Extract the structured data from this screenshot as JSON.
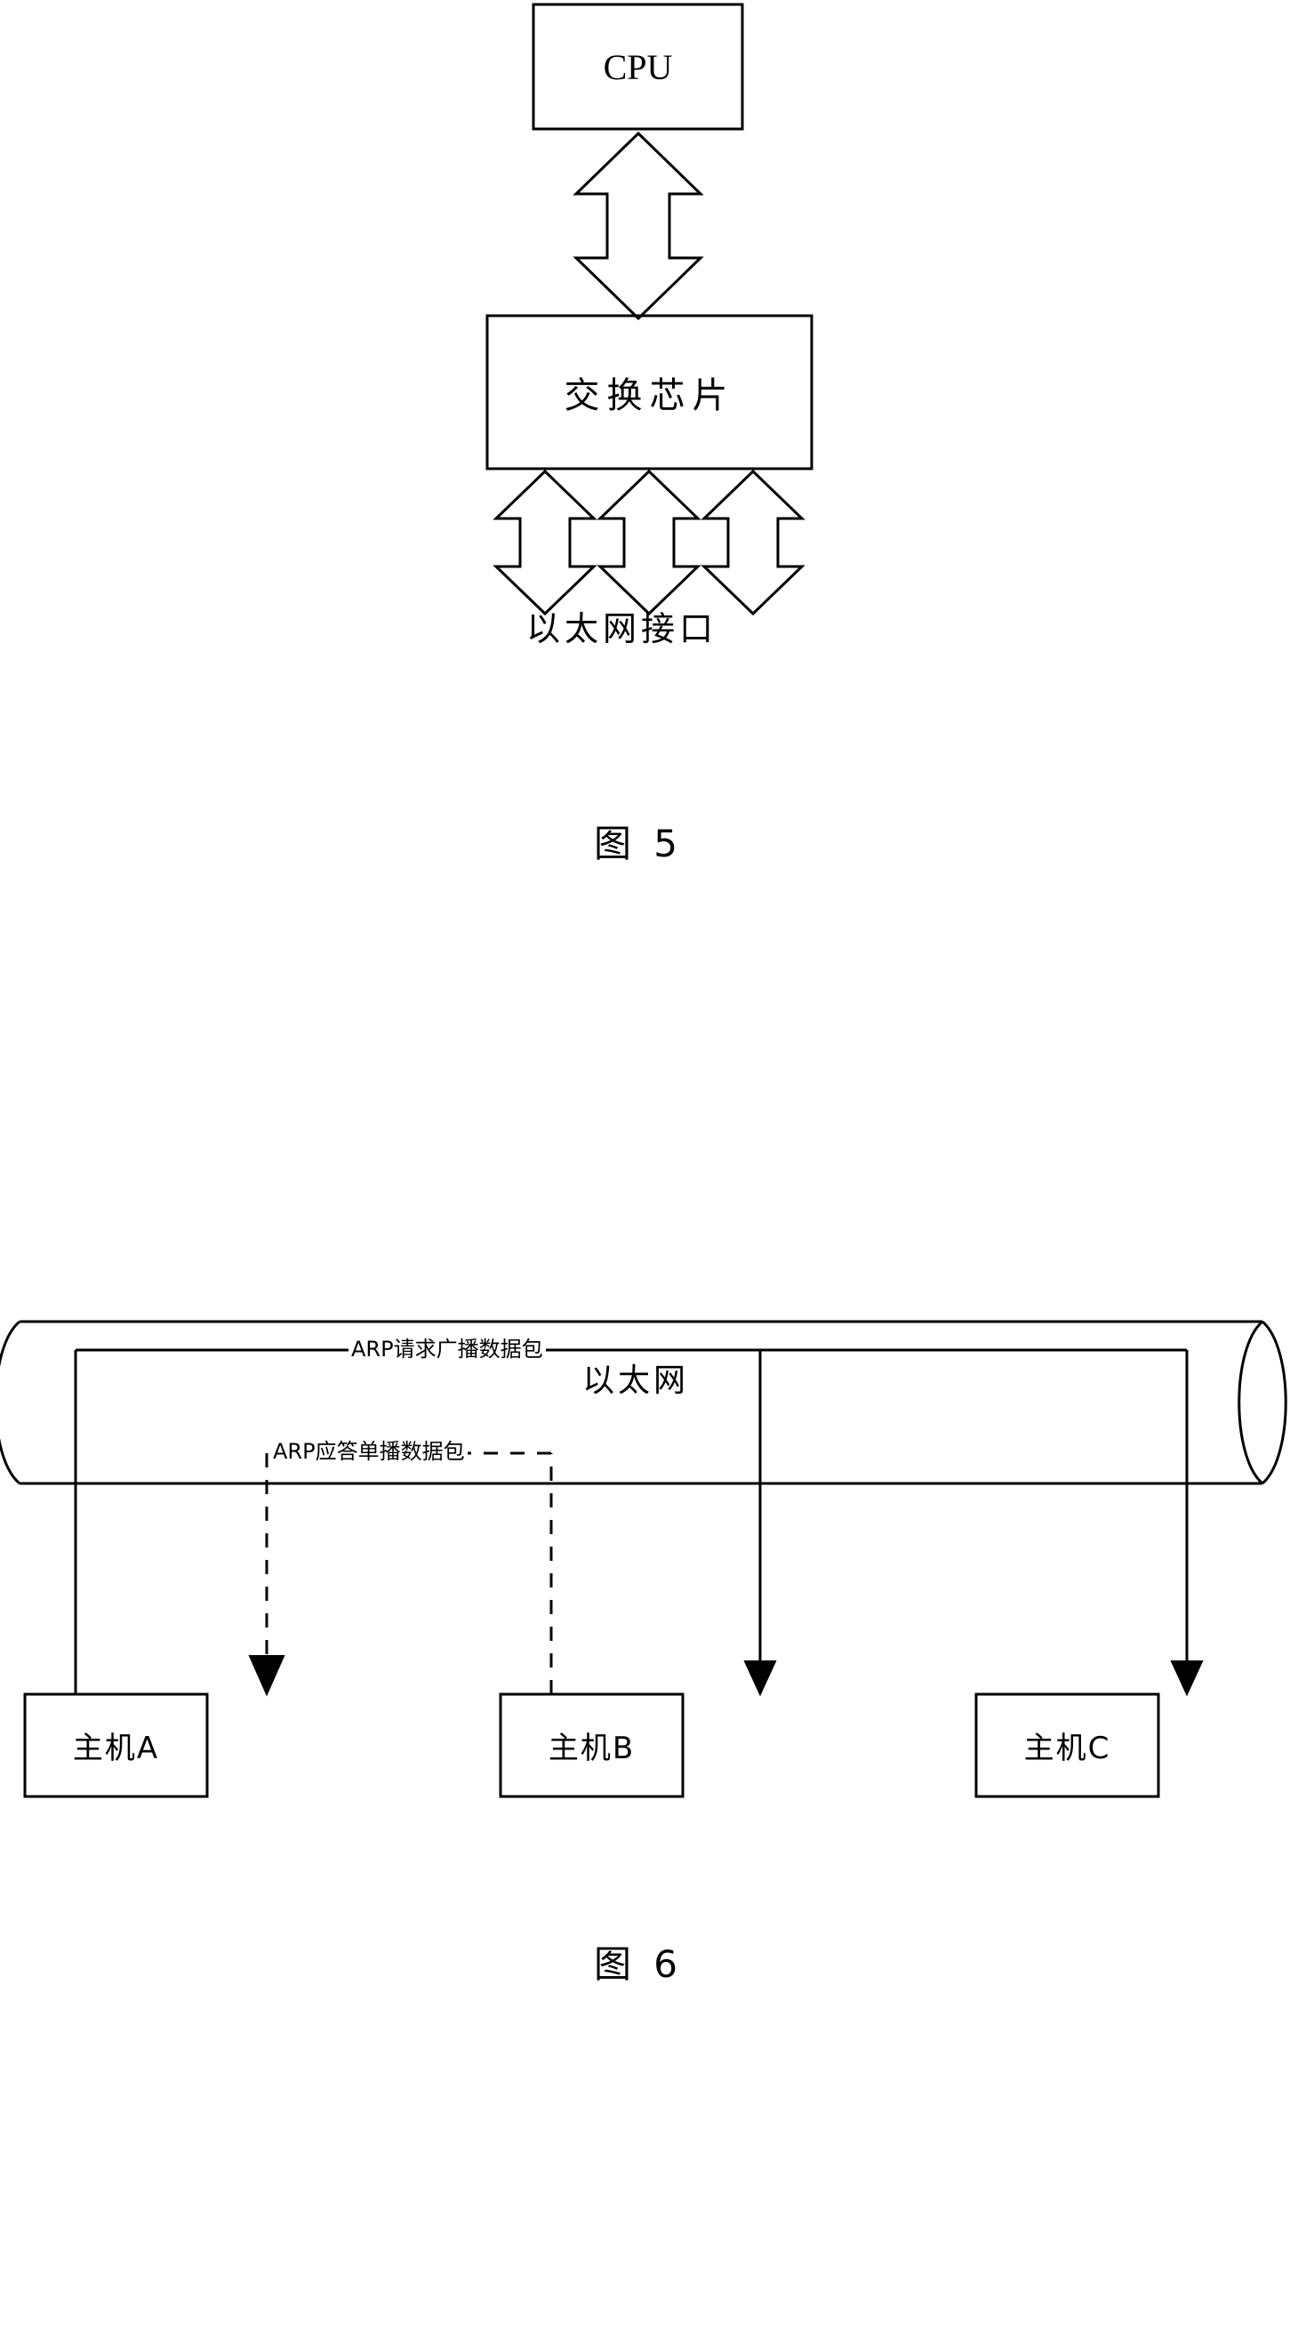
{
  "document": {
    "kind": "patent-drawing-sheet",
    "background_color": "#ffffff",
    "line_color": "#000000"
  },
  "figure5": {
    "caption": "图 5",
    "blocks": [
      {
        "id": "cpu",
        "label": "CPU",
        "script": "latin"
      },
      {
        "id": "switch-chip",
        "label": "交换芯片",
        "script": "cjk"
      }
    ],
    "interface_label": "以太网接口",
    "connectors": {
      "cpu_to_switch": {
        "style": "double-headed-block-arrow",
        "count": 1
      },
      "switch_to_ports": {
        "style": "double-headed-block-arrow",
        "count": 3
      }
    }
  },
  "figure6": {
    "caption": "图 6",
    "network": {
      "label": "以太网",
      "shape": "cylinder"
    },
    "hosts": [
      {
        "id": "host-a",
        "label": "主机A"
      },
      {
        "id": "host-b",
        "label": "主机B"
      },
      {
        "id": "host-c",
        "label": "主机C"
      }
    ],
    "flows": [
      {
        "id": "arp-request",
        "label": "ARP请求广播数据包",
        "line_style": "solid",
        "source": "主机A",
        "targets": [
          "主机A",
          "主机B",
          "主机C"
        ],
        "description": "broadcast"
      },
      {
        "id": "arp-reply",
        "label": "ARP应答单播数据包",
        "line_style": "dashed",
        "source": "主机B",
        "targets": [
          "主机A"
        ],
        "description": "unicast"
      }
    ]
  }
}
